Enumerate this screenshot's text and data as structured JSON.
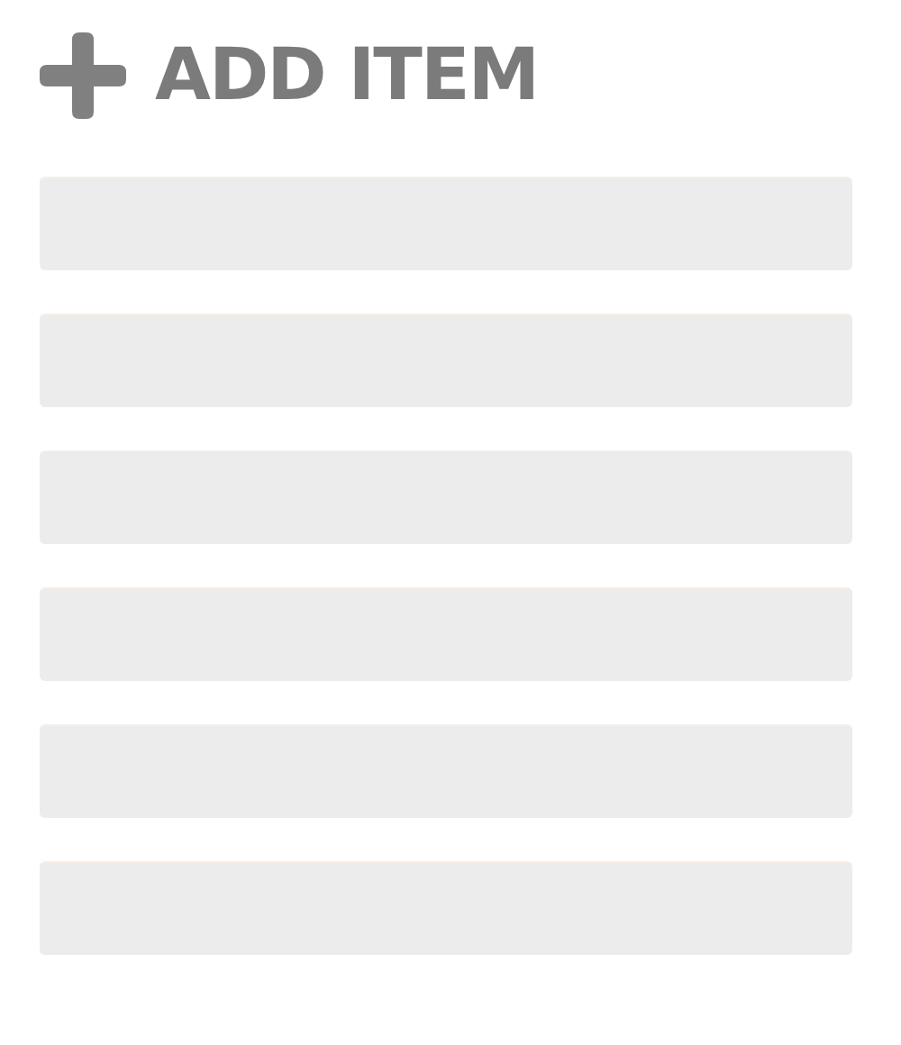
{
  "header": {
    "title": "ADD ITEM"
  },
  "item_slots": [
    {
      "kind": "empty"
    },
    {
      "kind": "empty"
    },
    {
      "kind": "empty"
    },
    {
      "kind": "empty"
    },
    {
      "kind": "empty"
    },
    {
      "kind": "empty"
    }
  ]
}
